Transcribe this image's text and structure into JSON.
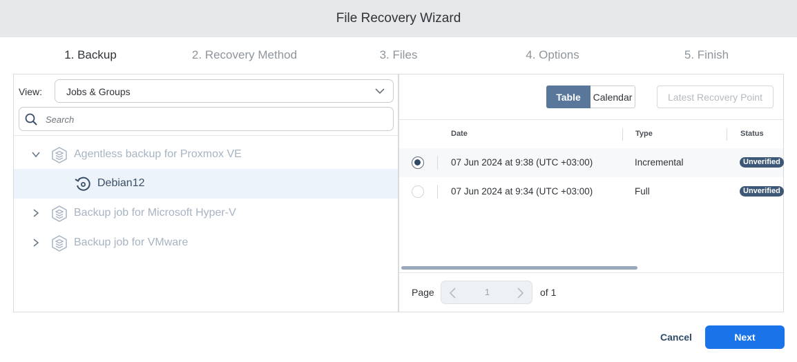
{
  "window": {
    "title": "File Recovery Wizard"
  },
  "steps": [
    {
      "label": "1. Backup",
      "active": true
    },
    {
      "label": "2. Recovery Method",
      "active": false
    },
    {
      "label": "3. Files",
      "active": false
    },
    {
      "label": "4. Options",
      "active": false
    },
    {
      "label": "5. Finish",
      "active": false
    }
  ],
  "left": {
    "view_label": "View:",
    "view_value": "Jobs & Groups",
    "search_placeholder": "Search",
    "tree": [
      {
        "label": "Agentless backup for Proxmox VE",
        "expanded": true,
        "icon": "job-stack-icon"
      },
      {
        "label": "Debian12",
        "selected": true,
        "icon": "vm-restore-icon"
      },
      {
        "label": "Backup job for Microsoft Hyper-V",
        "expanded": false,
        "icon": "job-stack-icon"
      },
      {
        "label": "Backup job for VMware",
        "expanded": false,
        "icon": "job-stack-icon"
      }
    ]
  },
  "right": {
    "toggle": {
      "table": "Table",
      "calendar": "Calendar"
    },
    "latest_button": "Latest Recovery Point",
    "columns": {
      "date": "Date",
      "type": "Type",
      "status": "Status"
    },
    "rows": [
      {
        "date": "07 Jun 2024 at 9:38 (UTC +03:00)",
        "type": "Incremental",
        "status": "Unverified",
        "selected": true
      },
      {
        "date": "07 Jun 2024 at 9:34 (UTC +03:00)",
        "type": "Full",
        "status": "Unverified",
        "selected": false
      }
    ],
    "pagination": {
      "page_label": "Page",
      "current": "1",
      "of_label": "of 1"
    }
  },
  "footer": {
    "cancel": "Cancel",
    "next": "Next"
  },
  "colors": {
    "primary": "#1a73e8",
    "toggle_active": "#58779b",
    "badge": "#3d5877",
    "selected_row": "#edf3fb"
  }
}
